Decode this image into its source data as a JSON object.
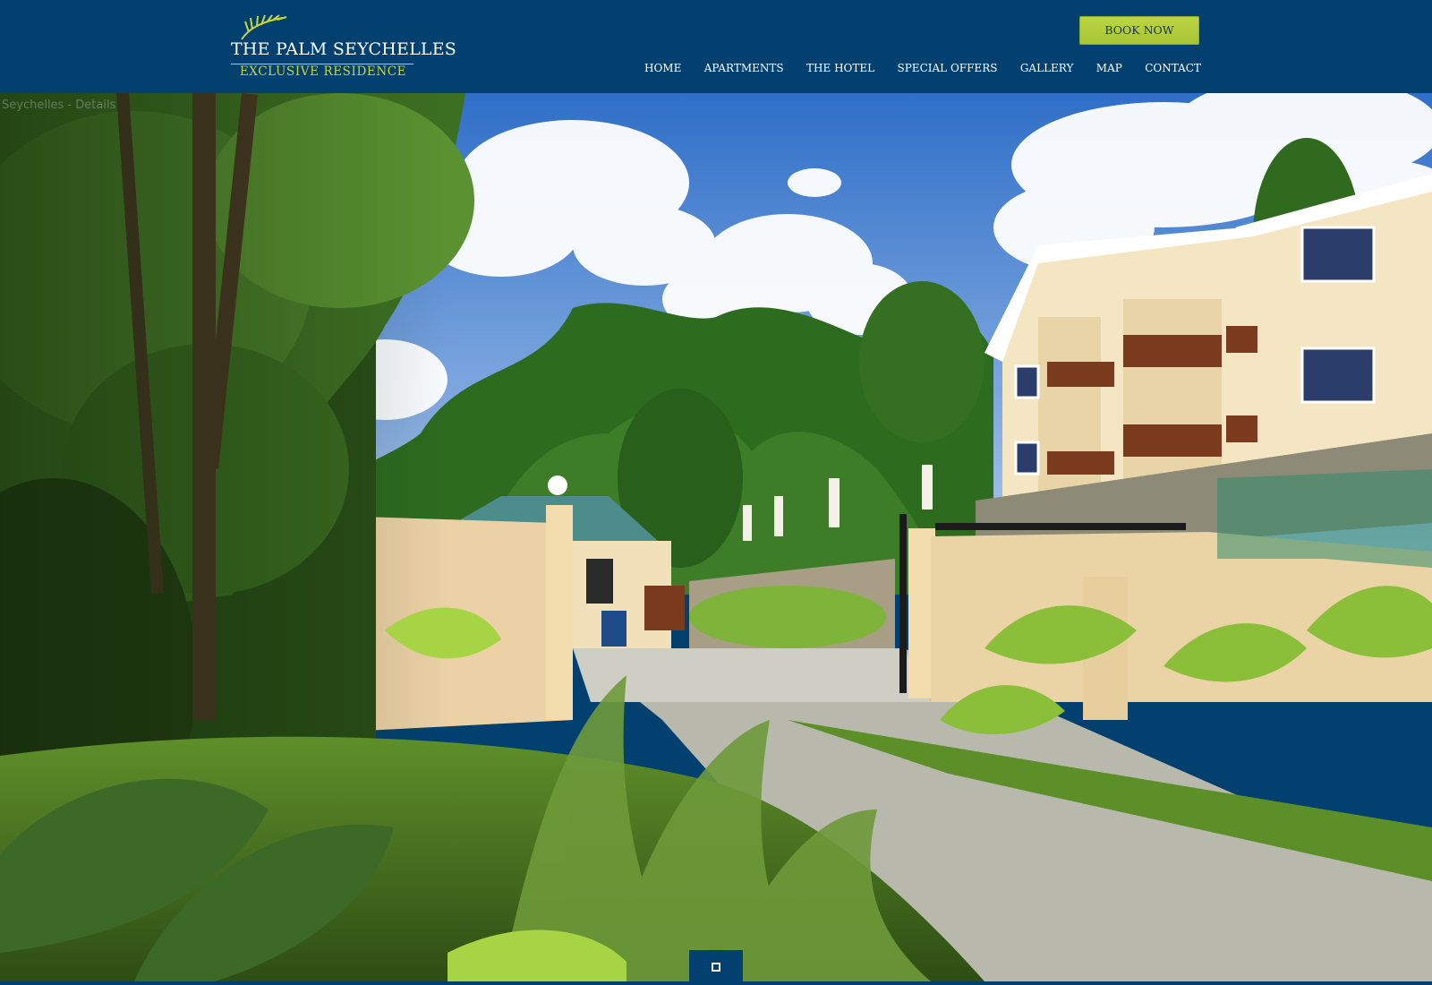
{
  "brand": {
    "name": "THE PALM SEYCHELLES",
    "tagline": "EXCLUSIVE RESIDENCE"
  },
  "header": {
    "book_label": "BOOK NOW"
  },
  "nav": {
    "items": [
      {
        "label": "HOME"
      },
      {
        "label": "APARTMENTS"
      },
      {
        "label": "THE HOTEL"
      },
      {
        "label": "SPECIAL OFFERS"
      },
      {
        "label": "GALLERY"
      },
      {
        "label": "MAP"
      },
      {
        "label": "CONTACT"
      }
    ]
  },
  "hero": {
    "caption": "Seychelles - Details"
  },
  "slideshow": {
    "toggle_icon": "stop-square-icon"
  },
  "colors": {
    "header_bg": "#01406f",
    "accent": "#bdd544",
    "logo_accent": "#c9d63a"
  }
}
